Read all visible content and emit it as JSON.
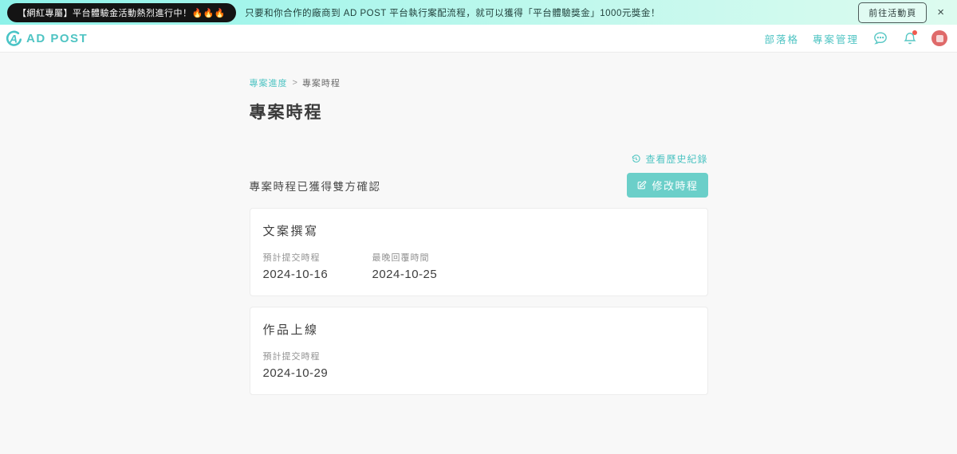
{
  "banner": {
    "badge": "【網紅專屬】平台體驗金活動熱烈進行中！🔥🔥🔥",
    "message": "只要和你合作的廠商到 AD POST 平台執行案配流程，就可以獲得「平台體驗獎金」1000元獎金！",
    "cta_label": "前往活動頁",
    "close_label": "×"
  },
  "navbar": {
    "logo_text": "AD POST",
    "links": [
      {
        "label": "部落格"
      },
      {
        "label": "專案管理"
      }
    ],
    "icons": [
      "chat-icon",
      "bell-icon"
    ],
    "has_notification_dot": true
  },
  "breadcrumb": {
    "parent": "專案進度",
    "separator": ">",
    "current": "專案時程"
  },
  "page": {
    "title": "專案時程"
  },
  "history_link": {
    "label": "查看歷史紀錄",
    "icon": "history-clock-icon"
  },
  "status": {
    "text": "專案時程已獲得雙方確認"
  },
  "edit_button": {
    "label": "修改時程",
    "icon": "edit-pencil-icon"
  },
  "cards": [
    {
      "title": "文案撰寫",
      "fields": [
        {
          "label": "預計提交時程",
          "value": "2024-10-16"
        },
        {
          "label": "最晚回覆時間",
          "value": "2024-10-25"
        }
      ]
    },
    {
      "title": "作品上線",
      "fields": [
        {
          "label": "預計提交時程",
          "value": "2024-10-29"
        }
      ]
    }
  ],
  "colors": {
    "accent": "#4fc4c3",
    "btn-bg": "#6bcfc9",
    "banner-left": "#8df2e9",
    "banner-right": "#ddfbef",
    "badge-bg": "#141414",
    "avatar-bg": "#df6a6a"
  }
}
